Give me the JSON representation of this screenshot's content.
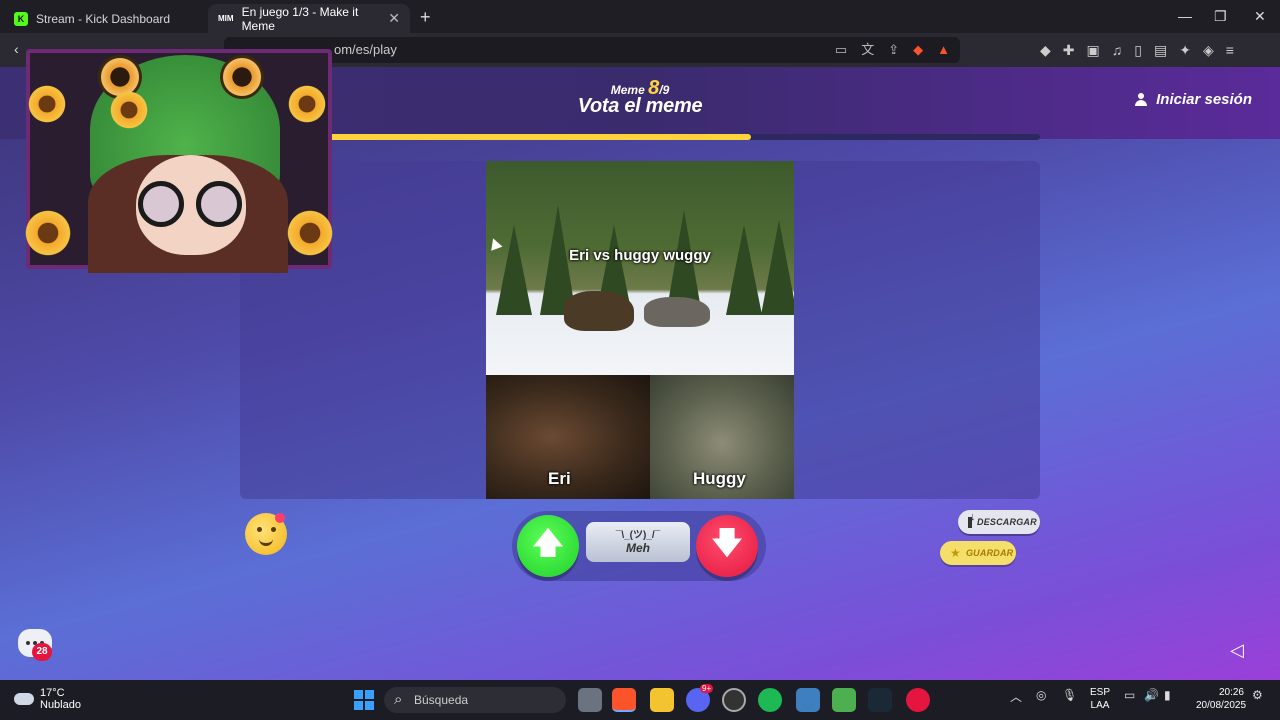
{
  "browser": {
    "tabs": [
      {
        "title": "Stream - Kick Dashboard",
        "favicon": "K"
      },
      {
        "title": "En juego 1/3 - Make it Meme",
        "favicon": "MIM"
      }
    ],
    "url_visible": "om/es/play",
    "new_tab": "+",
    "window": {
      "minimize": "—",
      "restore": "❐",
      "close": "✕"
    }
  },
  "game": {
    "meme_label": "Meme",
    "meme_current": "8",
    "meme_total": "/9",
    "title": "Vota el meme",
    "login": "Iniciar sesión",
    "round_progress": 0.63,
    "accent_color": "#ffd43b"
  },
  "meme": {
    "caption": "Eri vs huggy wuggy",
    "left_label": "Eri",
    "right_label": "Huggy"
  },
  "vote": {
    "up_icon": "arrow-up-icon",
    "down_icon": "arrow-down-icon",
    "meh_face": "¯\\_(ツ)_/¯",
    "meh_label": "Meh",
    "up_glyph": "🡅",
    "down_glyph": "🡇"
  },
  "actions": {
    "download": "DESCARGAR",
    "save": "GUARDAR"
  },
  "chat": {
    "badge": "28"
  },
  "taskbar": {
    "temperature": "17°C",
    "weather": "Nublado",
    "search": "Búsqueda",
    "lang_top": "ESP",
    "lang_bottom": "LAA",
    "time": "20:26",
    "date": "20/08/2025",
    "discord_badge": "9+"
  }
}
